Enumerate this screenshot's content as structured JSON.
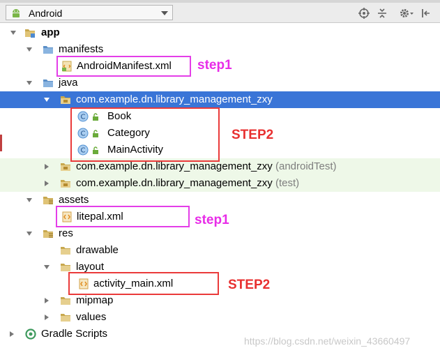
{
  "toolbar": {
    "view_label": "Android",
    "icons": [
      "android-icon",
      "target-icon",
      "collapse-icon",
      "gear-icon",
      "hide-icon"
    ]
  },
  "tree": {
    "app": "app",
    "manifests": "manifests",
    "android_manifest": "AndroidManifest.xml",
    "java": "java",
    "main_package": "com.example.dn.library_management_zxy",
    "book": "Book",
    "category": "Category",
    "main_activity": "MainActivity",
    "test_package_1": "com.example.dn.library_management_zxy",
    "test_package_1_suffix": "(androidTest)",
    "test_package_2": "com.example.dn.library_management_zxy",
    "test_package_2_suffix": "(test)",
    "assets": "assets",
    "litepal": "litepal.xml",
    "res": "res",
    "drawable": "drawable",
    "layout": "layout",
    "activity_main": "activity_main.xml",
    "mipmap": "mipmap",
    "values": "values",
    "gradle_scripts": "Gradle Scripts"
  },
  "annotations": {
    "step1_manifest": "step1",
    "step2_classes": "STEP2",
    "step1_litepal": "step1",
    "step2_layout": "STEP2"
  },
  "watermark": "https://blog.csdn.net/weixin_43660497",
  "colors": {
    "selection": "#3a75d7",
    "annotation_magenta": "#e43ee8",
    "annotation_red": "#ea3a3a",
    "folder": "#c8a84e",
    "class_icon": "#4f8fd1",
    "xml_icon": "#e08a1e"
  }
}
